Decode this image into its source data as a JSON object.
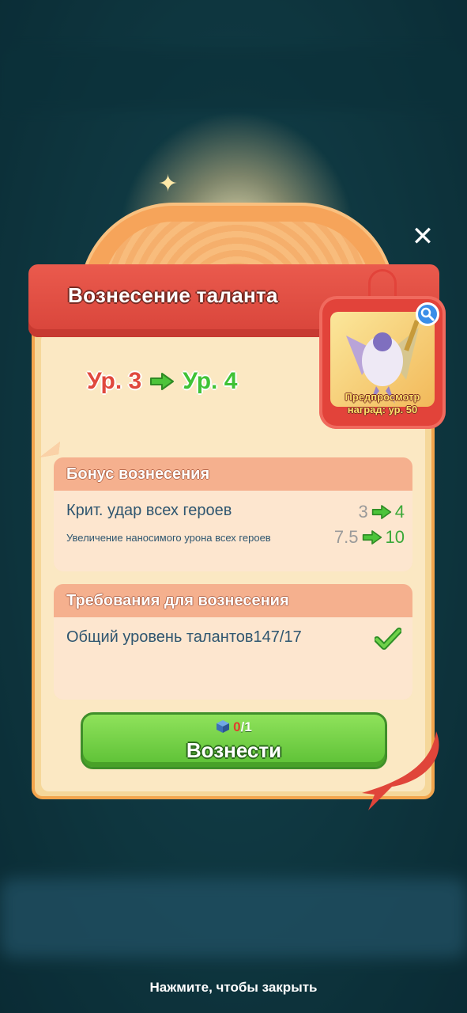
{
  "dialog": {
    "title": "Вознесение таланта",
    "level_from": "Ур. 3",
    "level_to": "Ур. 4",
    "reward_preview": "Предпросмотр наград: ур. 50"
  },
  "bonus": {
    "header": "Бонус вознесения",
    "rows": [
      {
        "label": "Крит. удар всех героев",
        "from": "3",
        "to": "4"
      },
      {
        "label": "Увеличение наносимого урона всех героев",
        "from": "7.5",
        "to": "10"
      }
    ]
  },
  "requirements": {
    "header": "Требования для вознесения",
    "rows": [
      {
        "label": "Общий уровень талантов147/17",
        "status": "check-icon"
      }
    ]
  },
  "ascend_button": {
    "cost_have": "0",
    "cost_need": "/1",
    "label": "Вознести"
  },
  "footer": {
    "hint": "Нажмите, чтобы закрыть"
  },
  "colors": {
    "banner": "#e2433a",
    "panel": "#f5d79a",
    "button": "#5cc035",
    "level_current": "#e0483d",
    "level_next": "#3fc236"
  }
}
